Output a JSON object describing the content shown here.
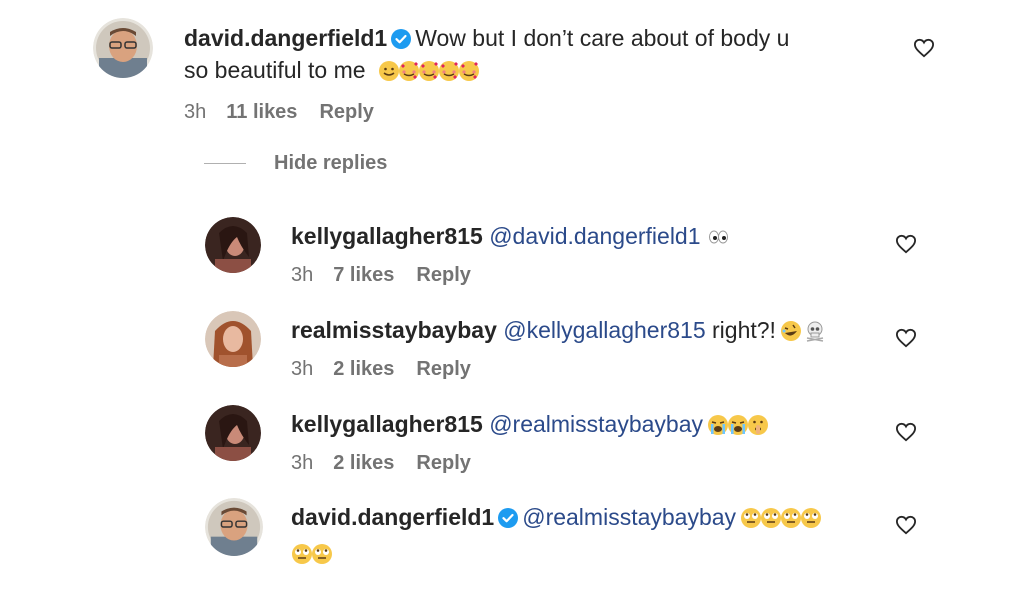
{
  "comments": [
    {
      "username": "david.dangerfield1",
      "verified": true,
      "text_line1": "Wow but I don’t care about of body u",
      "text_line2": "so beautiful to me",
      "time": "3h",
      "likes": "11 likes",
      "reply": "Reply"
    }
  ],
  "hide_replies": "Hide replies",
  "replies": [
    {
      "username": "kellygallagher815",
      "mention": "@david.dangerfield1",
      "text": "",
      "time": "3h",
      "likes": "7 likes",
      "reply": "Reply"
    },
    {
      "username": "realmisstaybaybay",
      "mention": "@kellygallagher815",
      "text": "right?!",
      "time": "3h",
      "likes": "2 likes",
      "reply": "Reply"
    },
    {
      "username": "kellygallagher815",
      "mention": "@realmisstaybaybay",
      "text": "",
      "time": "3h",
      "likes": "2 likes",
      "reply": "Reply"
    },
    {
      "username": "david.dangerfield1",
      "verified": true,
      "mention": "@realmisstaybaybay",
      "text": ""
    }
  ],
  "colors": {
    "mention": "#2b4a8a",
    "meta": "#737373",
    "verified": "#1d9bf0"
  },
  "icons": [
    "heart-icon",
    "verified-icon",
    "emoji-smile",
    "emoji-hearts",
    "emoji-eyes",
    "emoji-rofl",
    "emoji-skull",
    "emoji-sob",
    "emoji-shushing",
    "emoji-rolling-eyes"
  ]
}
